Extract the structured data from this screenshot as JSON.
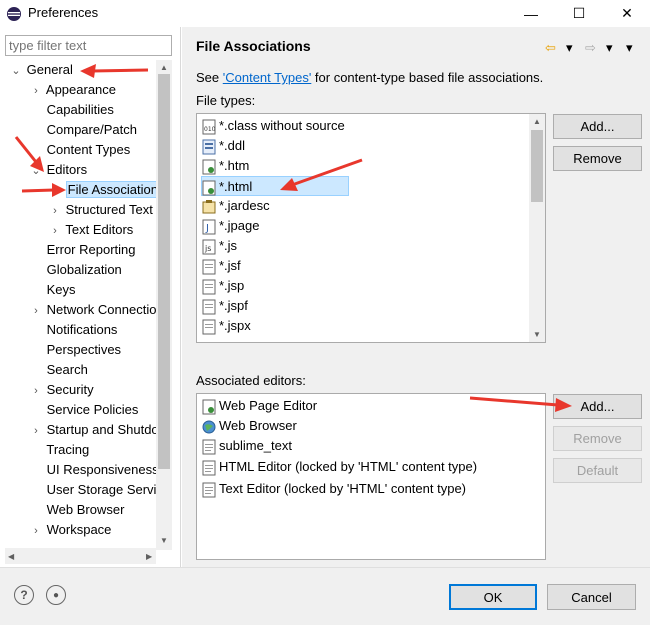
{
  "window": {
    "title": "Preferences",
    "minimize": "—",
    "maximize": "☐",
    "close": "✕"
  },
  "filter": {
    "placeholder": "type filter text"
  },
  "tree": {
    "items": [
      {
        "label": "General",
        "expander": "⌄"
      },
      {
        "label": "Appearance",
        "expander": "›"
      },
      {
        "label": "Capabilities",
        "expander": ""
      },
      {
        "label": "Compare/Patch",
        "expander": ""
      },
      {
        "label": "Content Types",
        "expander": ""
      },
      {
        "label": "Editors",
        "expander": "⌄"
      },
      {
        "label": "File Associations",
        "expander": ""
      },
      {
        "label": "Structured Text",
        "expander": "›"
      },
      {
        "label": "Text Editors",
        "expander": "›"
      },
      {
        "label": "Error Reporting",
        "expander": ""
      },
      {
        "label": "Globalization",
        "expander": ""
      },
      {
        "label": "Keys",
        "expander": ""
      },
      {
        "label": "Network Connections",
        "expander": "›"
      },
      {
        "label": "Notifications",
        "expander": ""
      },
      {
        "label": "Perspectives",
        "expander": ""
      },
      {
        "label": "Search",
        "expander": ""
      },
      {
        "label": "Security",
        "expander": "›"
      },
      {
        "label": "Service Policies",
        "expander": ""
      },
      {
        "label": "Startup and Shutdown",
        "expander": "›"
      },
      {
        "label": "Tracing",
        "expander": ""
      },
      {
        "label": "UI Responsiveness",
        "expander": ""
      },
      {
        "label": "User Storage Service",
        "expander": ""
      },
      {
        "label": "Web Browser",
        "expander": ""
      },
      {
        "label": "Workspace",
        "expander": "›"
      }
    ]
  },
  "page": {
    "title": "File Associations",
    "see_prefix": "See ",
    "see_link": "'Content Types'",
    "see_suffix": " for content-type based file associations.",
    "file_types_label": "File types:",
    "associated_label": "Associated editors:"
  },
  "nav": {
    "back": "⇦",
    "back_menu": "▾",
    "forward": "⇨",
    "forward_menu": "▾",
    "view_menu": "▾"
  },
  "file_types": [
    {
      "name": "*.class without source",
      "icon": "class-file-icon"
    },
    {
      "name": "*.ddl",
      "icon": "ddl-file-icon"
    },
    {
      "name": "*.htm",
      "icon": "htm-file-icon"
    },
    {
      "name": "*.html",
      "icon": "html-file-icon"
    },
    {
      "name": "*.jardesc",
      "icon": "jardesc-file-icon"
    },
    {
      "name": "*.jpage",
      "icon": "jpage-file-icon"
    },
    {
      "name": "*.js",
      "icon": "js-file-icon"
    },
    {
      "name": "*.jsf",
      "icon": "jsf-file-icon"
    },
    {
      "name": "*.jsp",
      "icon": "jsp-file-icon"
    },
    {
      "name": "*.jspf",
      "icon": "jspf-file-icon"
    },
    {
      "name": "*.jspx",
      "icon": "jspx-file-icon"
    }
  ],
  "editors": [
    {
      "name": "Web Page Editor",
      "icon": "web-page-editor-icon"
    },
    {
      "name": "Web Browser",
      "icon": "globe-icon"
    },
    {
      "name": "sublime_text",
      "icon": "file-icon"
    },
    {
      "name": "HTML Editor (locked by 'HTML' content type)",
      "icon": "file-icon"
    },
    {
      "name": "Text Editor (locked by 'HTML' content type)",
      "icon": "file-icon"
    }
  ],
  "buttons": {
    "ft_add": "Add...",
    "ft_remove": "Remove",
    "ae_add": "Add...",
    "ae_remove": "Remove",
    "ae_default": "Default",
    "ok": "OK",
    "cancel": "Cancel"
  },
  "help": {
    "help_glyph": "?",
    "import_glyph": "●"
  },
  "colors": {
    "selection": "#cce8ff",
    "link": "#0066cc",
    "annotation_arrow": "#e8372c"
  }
}
